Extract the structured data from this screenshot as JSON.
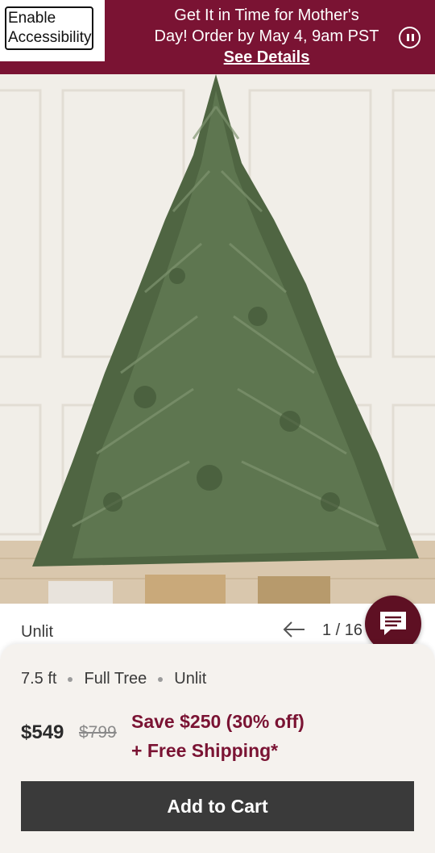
{
  "banner": {
    "accessibility_line1": "Enable",
    "accessibility_line2": "Accessibility",
    "promo_line1": "Get It in Time for Mother's",
    "promo_line2": "Day! Order by May 4, 9am PST",
    "link": "See Details",
    "bg_color": "#7a1333"
  },
  "gallery": {
    "caption": "Unlit",
    "counter": "1 / 16"
  },
  "product": {
    "options": [
      "7.5 ft",
      "Full Tree",
      "Unlit"
    ],
    "price": "$549",
    "original_price": "$799",
    "savings": "Save $250 (30% off)",
    "shipping": "+ Free Shipping*",
    "cta": "Add to Cart"
  },
  "icons": [
    "pause-icon",
    "left-arrow-icon",
    "chat-icon"
  ]
}
